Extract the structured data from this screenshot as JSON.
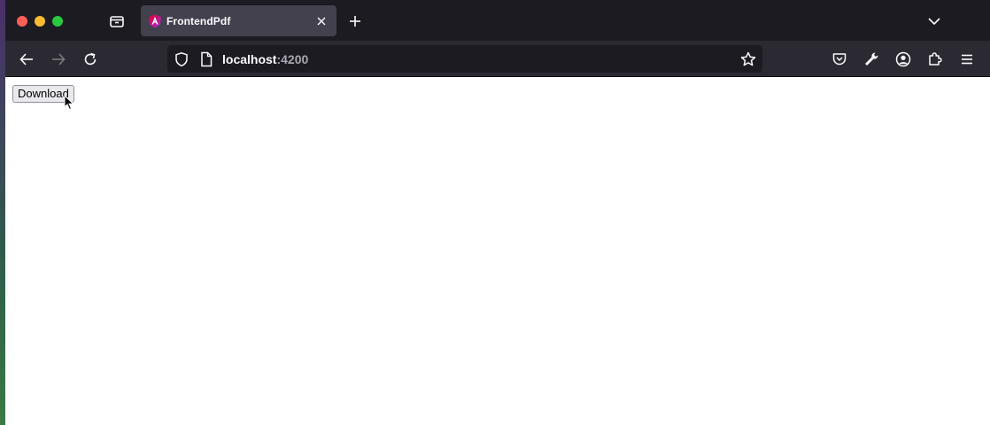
{
  "browser": {
    "tab": {
      "title": "FrontendPdf"
    },
    "urlbar": {
      "host": "localhost",
      "port": ":4200"
    },
    "icons": {
      "tab_overview": "tab-overview-icon",
      "favicon": "angular-favicon",
      "tab_close": "close-icon",
      "new_tab": "plus-icon",
      "tab_list": "chevron-down-icon",
      "back": "back-arrow-icon",
      "forward": "forward-arrow-icon",
      "reload": "reload-icon",
      "tracking_protection": "shield-icon",
      "page_info": "page-icon",
      "bookmark": "star-icon",
      "pocket": "pocket-icon",
      "devtools": "wrench-icon",
      "account": "account-icon",
      "extensions": "puzzle-icon",
      "menu": "hamburger-menu-icon"
    },
    "colors": {
      "close": "#ff5f57",
      "minimize": "#febc2e",
      "maximize": "#28c840",
      "chrome": "#1c1b22",
      "toolbar": "#2b2a33",
      "active_tab": "#42414d"
    }
  },
  "page": {
    "download_button_label": "Download"
  }
}
